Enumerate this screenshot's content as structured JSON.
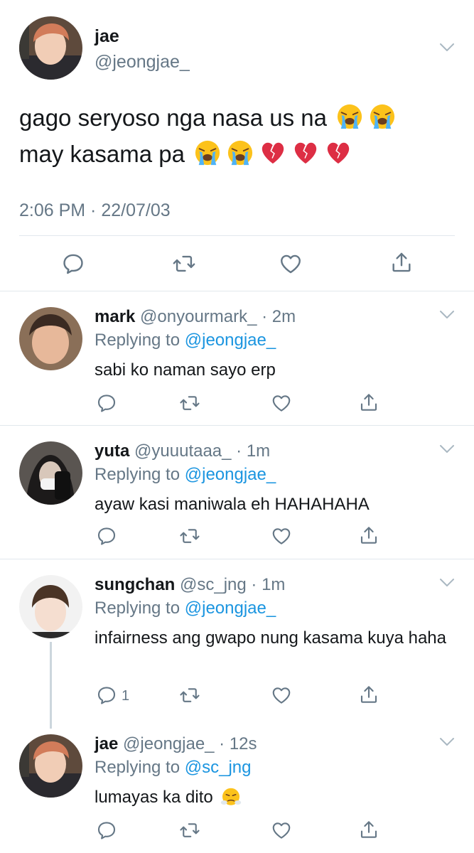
{
  "main_tweet": {
    "name": "jae",
    "handle": "@jeongjae_",
    "text_line1": "gago seryoso nga nasa us na",
    "text_line2": "may kasama pa",
    "timestamp": "2:06 PM · 22/07/03"
  },
  "replies": [
    {
      "name": "mark",
      "meta": "@onyourmark_ · 2m",
      "replying_prefix": "Replying to ",
      "replying_to": "@jeongjae_",
      "body": "sabi ko naman sayo erp",
      "reply_count": ""
    },
    {
      "name": "yuta",
      "meta": "@yuuutaaa_ · 1m",
      "replying_prefix": "Replying to ",
      "replying_to": "@jeongjae_",
      "body": "ayaw kasi maniwala eh HAHAHAHA",
      "reply_count": ""
    },
    {
      "name": "sungchan",
      "meta": "@sc_jng · 1m",
      "replying_prefix": "Replying to ",
      "replying_to": "@jeongjae_",
      "body": "infairness ang gwapo nung kasama kuya haha",
      "reply_count": "1"
    },
    {
      "name": "jae",
      "meta": "@jeongjae_ · 12s",
      "replying_prefix": "Replying to ",
      "replying_to": "@sc_jng",
      "body": "lumayas ka dito",
      "reply_count": ""
    }
  ],
  "icons": {
    "reply": "reply-icon",
    "retweet": "retweet-icon",
    "like": "heart-icon",
    "share": "share-icon",
    "menu": "chevron-down-icon",
    "emoji_cry": "loudly-crying-face-emoji",
    "emoji_broken_heart": "broken-heart-emoji",
    "emoji_steam": "face-with-steam-emoji"
  },
  "colors": {
    "text": "#14171a",
    "secondary": "#657786",
    "link": "#1b95e0",
    "divider": "#e1e8ed"
  }
}
